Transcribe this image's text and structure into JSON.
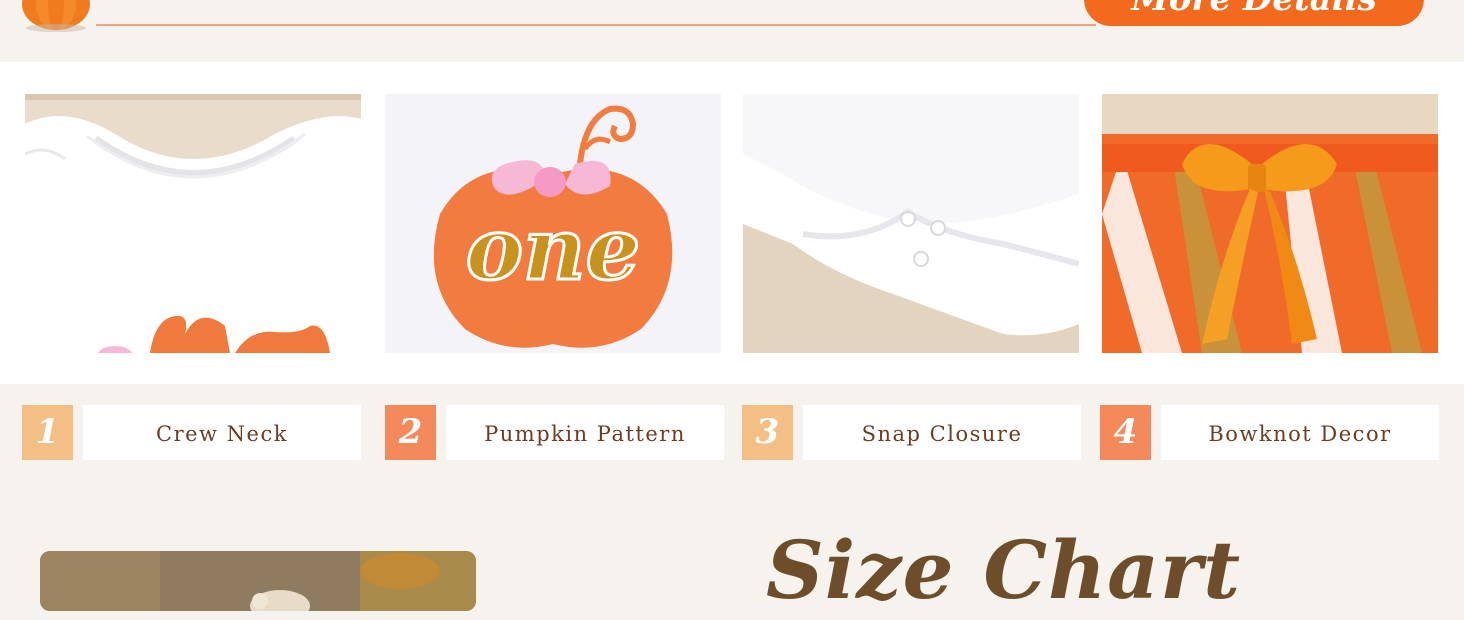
{
  "header": {
    "text": "",
    "more_button_label": "More Details"
  },
  "features": [
    {
      "number": "1",
      "label": "Crew Neck",
      "color": "#f4bf85"
    },
    {
      "number": "2",
      "label": "Pumpkin Pattern",
      "color": "#f48a5c"
    },
    {
      "number": "3",
      "label": "Snap Closure",
      "color": "#f4bf85"
    },
    {
      "number": "4",
      "label": "Bowknot Decor",
      "color": "#f48a5c"
    }
  ],
  "photos": [
    {
      "name": "crew-neck-photo"
    },
    {
      "name": "pumpkin-pattern-photo",
      "print_text": "one"
    },
    {
      "name": "snap-closure-photo"
    },
    {
      "name": "bowknot-decor-photo"
    }
  ],
  "size_chart": {
    "title": "Size Chart"
  },
  "colors": {
    "accent": "#f36a1e",
    "background": "#f6f2ee",
    "label_text": "#6b3d22",
    "title_text": "#6e4e2a"
  }
}
